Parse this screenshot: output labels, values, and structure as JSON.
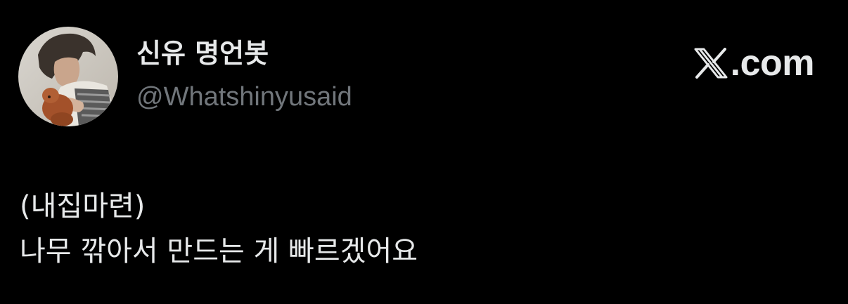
{
  "author": {
    "display_name": "신유 명언봇",
    "handle": "@Whatshinyusaid",
    "avatar": "profile-photo-person-holding-puppy"
  },
  "brand": {
    "domain": "com",
    "icon": "x-logo-icon"
  },
  "post": {
    "lines": [
      "(내집마련)",
      "나무 깎아서 만드는 게 빠르겠어요"
    ]
  },
  "colors": {
    "background": "#000000",
    "primary_text": "#e7e9ea",
    "secondary_text": "#71767b"
  }
}
